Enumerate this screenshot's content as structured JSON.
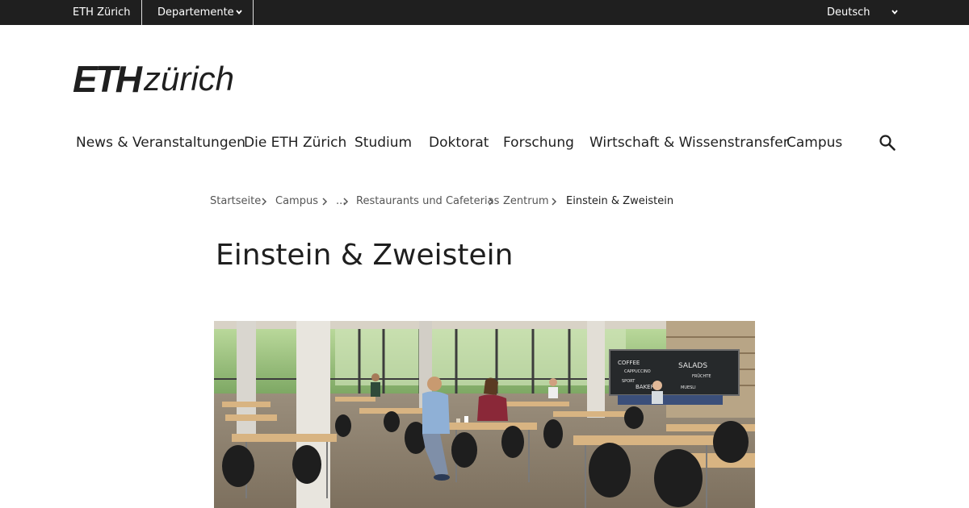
{
  "topbar": {
    "home_label": "ETH Zürich",
    "departments_label": "Departemente",
    "language_label": "Deutsch"
  },
  "logo": {
    "eth": "ETH",
    "zurich": "zürich"
  },
  "nav": {
    "items": [
      "News & Veranstaltungen",
      "Die ETH Zürich",
      "Studium",
      "Doktorat",
      "Forschung",
      "Wirtschaft & Wissenstransfer",
      "Campus"
    ],
    "search_icon": "search-icon"
  },
  "breadcrumb": {
    "items": [
      "Startseite",
      "Campus",
      "...",
      "Restaurants und Cafeterias",
      "Zentrum",
      "Einstein & Zweistein"
    ]
  },
  "page": {
    "title": "Einstein & Zweistein"
  },
  "hero": {
    "chalkboard_lines": [
      "COFFEE",
      "SALADS",
      "CAPPUCCINO",
      "FRÜCHTE",
      "SPORT",
      "BAKERY",
      "MUESLI"
    ]
  },
  "colors": {
    "topbar_bg": "#1f1f1f",
    "text": "#1f1f1f",
    "muted": "#555555"
  }
}
